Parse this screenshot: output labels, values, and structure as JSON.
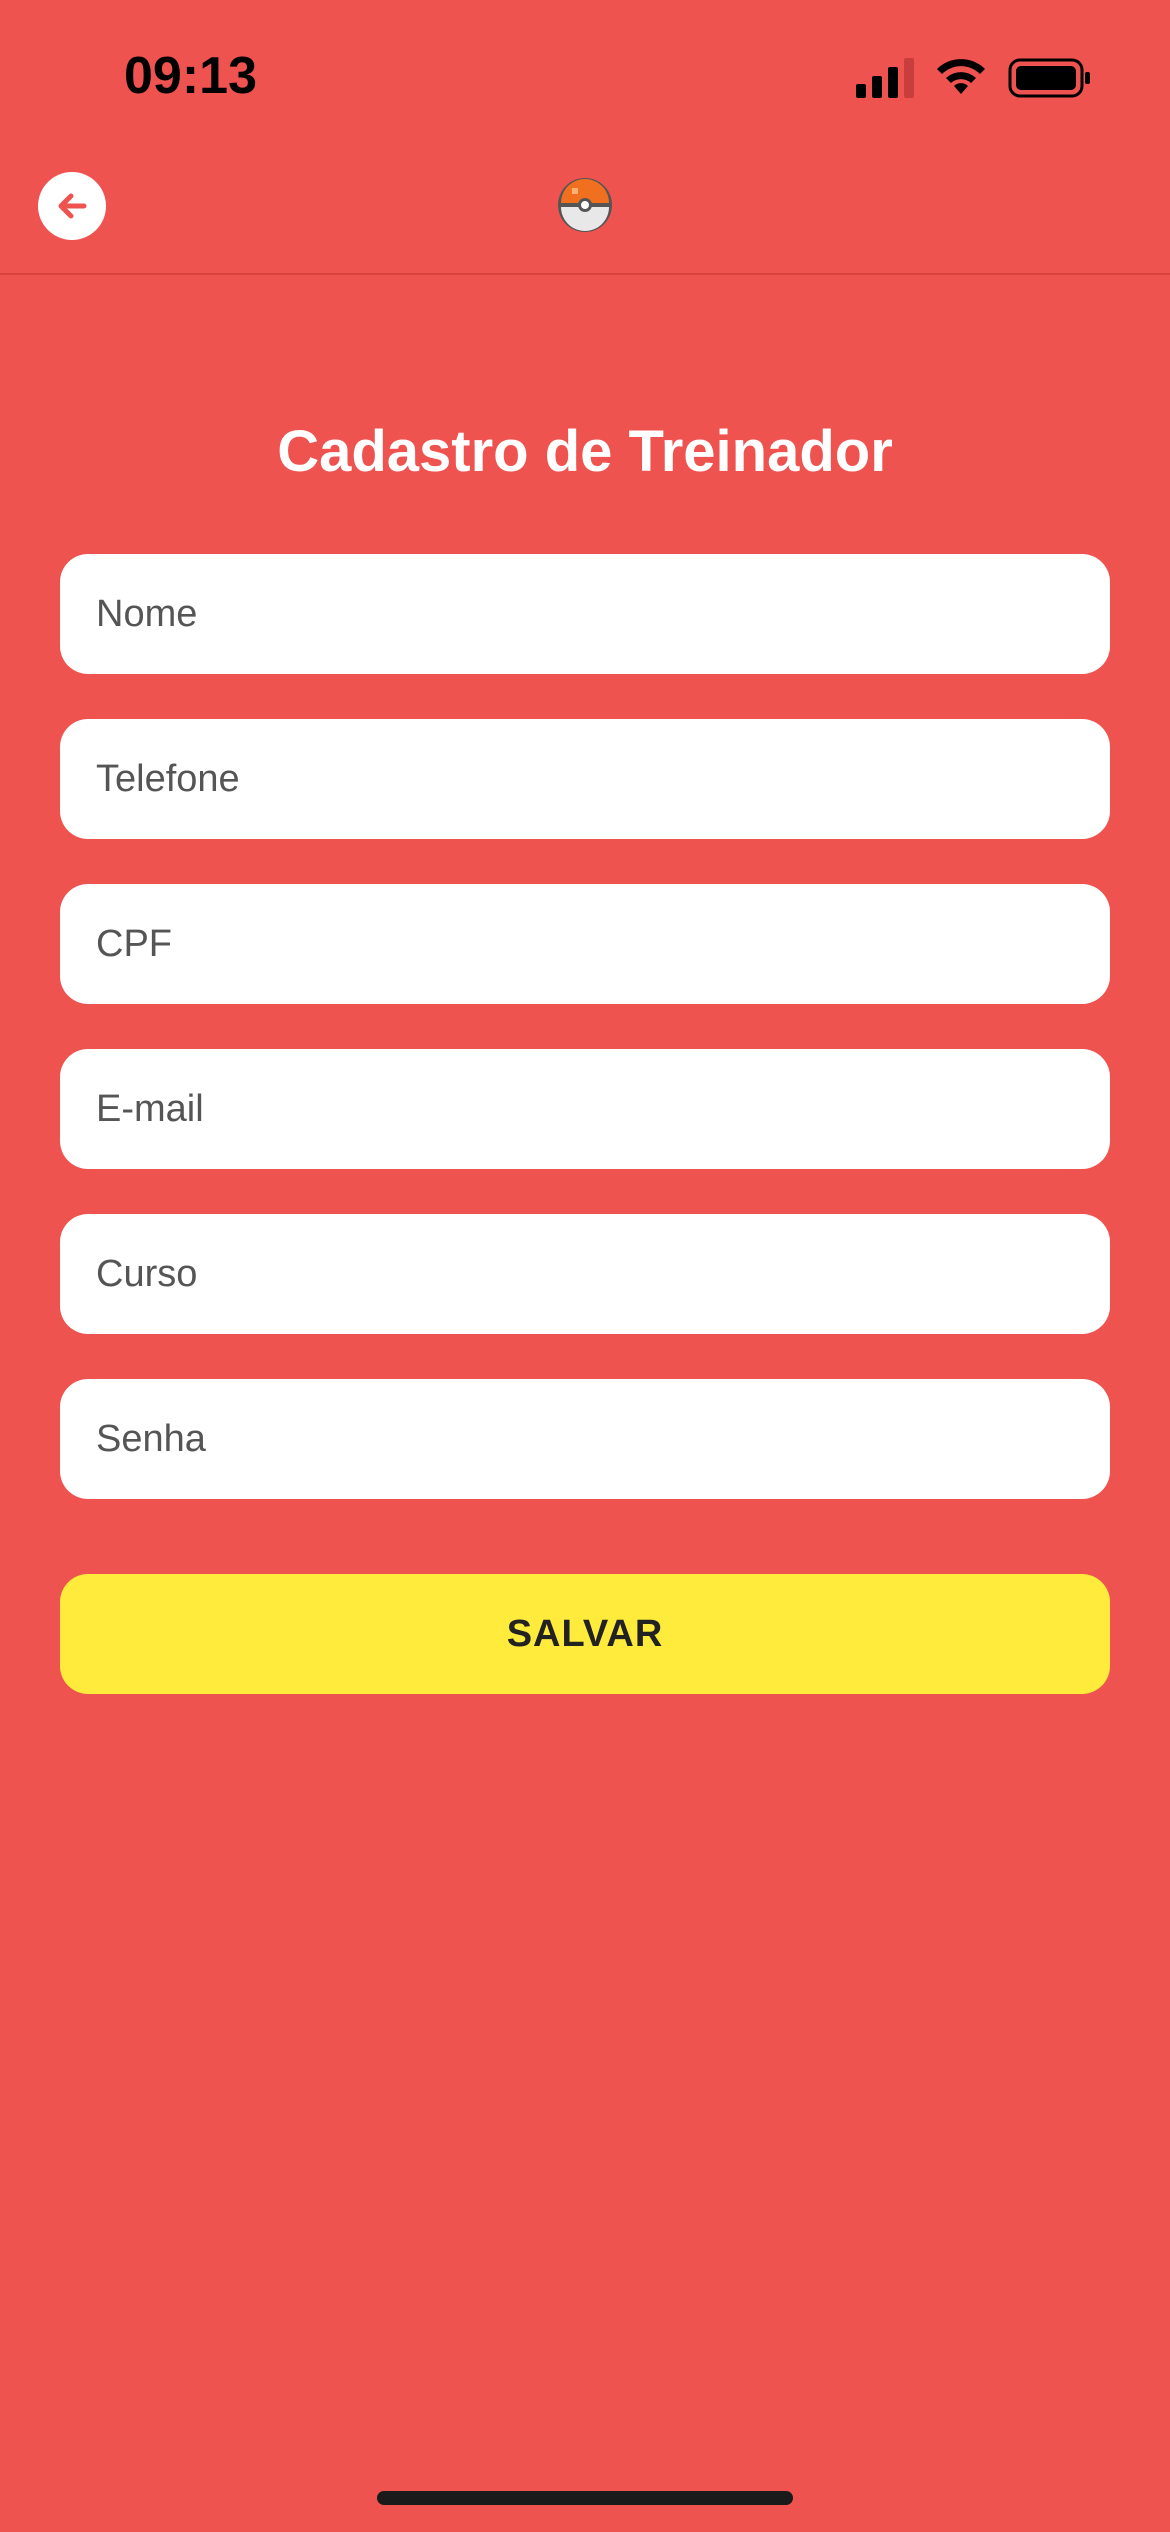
{
  "status_bar": {
    "time": "09:13"
  },
  "nav": {
    "back_icon": "arrow-left-icon",
    "logo_icon": "pokeball-icon"
  },
  "form": {
    "title": "Cadastro de Treinador",
    "fields": [
      {
        "placeholder": "Nome",
        "value": ""
      },
      {
        "placeholder": "Telefone",
        "value": ""
      },
      {
        "placeholder": "CPF",
        "value": ""
      },
      {
        "placeholder": "E-mail",
        "value": ""
      },
      {
        "placeholder": "Curso",
        "value": ""
      },
      {
        "placeholder": "Senha",
        "value": ""
      }
    ],
    "save_label": "SALVAR"
  },
  "colors": {
    "background": "#EF5350",
    "button": "#FFEB3B",
    "field": "#FFFFFF"
  }
}
